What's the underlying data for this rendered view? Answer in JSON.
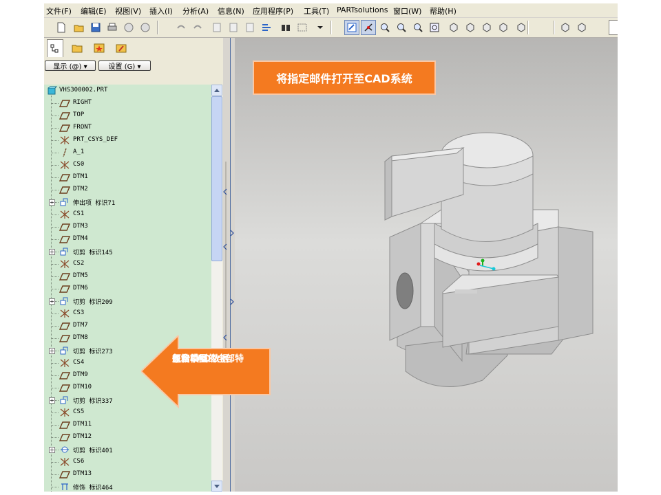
{
  "menu": [
    "文件(F)",
    "编辑(E)",
    "视图(V)",
    "插入(I)",
    "分析(A)",
    "信息(N)",
    "应用程序(P)",
    "工具(T)",
    "PARTsolutions",
    "窗口(W)",
    "帮助(H)"
  ],
  "toolbar_icons": [
    "new-icon",
    "open-icon",
    "save-icon",
    "print-icon",
    "email-icon",
    "email-attach-icon",
    "undo-icon",
    "redo-icon",
    "copy-icon",
    "paste-icon",
    "paste-special-icon",
    "regenerate-icon",
    "find-icon",
    "select-box-icon",
    "select-dropdown-icon",
    "repaint-icon",
    "spin-center-icon",
    "orient-icon",
    "zoom-in-icon",
    "zoom-out-icon",
    "refit-icon",
    "reorient-icon",
    "saved-views-icon",
    "layers-icon",
    "view-manager-icon",
    "shading-icon",
    "hidden-line-icon",
    "no-hidden-icon"
  ],
  "nav": {
    "tabs": [
      "model-tree-tab",
      "folder-browser-tab",
      "favorites-tab",
      "connections-tab"
    ],
    "show_label": "显示 (@) ▾",
    "settings_label": "设置 (G) ▾"
  },
  "tree": [
    {
      "label": "VHS300002.PRT",
      "type": "part",
      "indent": 0,
      "expand": false
    },
    {
      "label": "RIGHT",
      "type": "plane",
      "indent": 1,
      "expand": false
    },
    {
      "label": "TOP",
      "type": "plane",
      "indent": 1,
      "expand": false
    },
    {
      "label": "FRONT",
      "type": "plane",
      "indent": 1,
      "expand": false
    },
    {
      "label": "PRT_CSYS_DEF",
      "type": "csys",
      "indent": 1,
      "expand": false
    },
    {
      "label": "A_1",
      "type": "axis",
      "indent": 1,
      "expand": false
    },
    {
      "label": "CS0",
      "type": "csys",
      "indent": 1,
      "expand": false
    },
    {
      "label": "DTM1",
      "type": "plane",
      "indent": 1,
      "expand": false
    },
    {
      "label": "DTM2",
      "type": "plane",
      "indent": 1,
      "expand": false
    },
    {
      "label": "伸出项 标识71",
      "type": "extrude",
      "indent": 1,
      "expand": true
    },
    {
      "label": "CS1",
      "type": "csys",
      "indent": 1,
      "expand": false
    },
    {
      "label": "DTM3",
      "type": "plane",
      "indent": 1,
      "expand": false
    },
    {
      "label": "DTM4",
      "type": "plane",
      "indent": 1,
      "expand": false
    },
    {
      "label": "切剪 标识145",
      "type": "cut",
      "indent": 1,
      "expand": true
    },
    {
      "label": "CS2",
      "type": "csys",
      "indent": 1,
      "expand": false
    },
    {
      "label": "DTM5",
      "type": "plane",
      "indent": 1,
      "expand": false
    },
    {
      "label": "DTM6",
      "type": "plane",
      "indent": 1,
      "expand": false
    },
    {
      "label": "切剪 标识209",
      "type": "cut",
      "indent": 1,
      "expand": true
    },
    {
      "label": "CS3",
      "type": "csys",
      "indent": 1,
      "expand": false
    },
    {
      "label": "DTM7",
      "type": "plane",
      "indent": 1,
      "expand": false
    },
    {
      "label": "DTM8",
      "type": "plane",
      "indent": 1,
      "expand": false
    },
    {
      "label": "切剪 标识273",
      "type": "cut",
      "indent": 1,
      "expand": true
    },
    {
      "label": "CS4",
      "type": "csys",
      "indent": 1,
      "expand": false
    },
    {
      "label": "DTM9",
      "type": "plane",
      "indent": 1,
      "expand": false
    },
    {
      "label": "DTM10",
      "type": "plane",
      "indent": 1,
      "expand": false
    },
    {
      "label": "切剪 标识337",
      "type": "cut",
      "indent": 1,
      "expand": true
    },
    {
      "label": "CS5",
      "type": "csys",
      "indent": 1,
      "expand": false
    },
    {
      "label": "DTM11",
      "type": "plane",
      "indent": 1,
      "expand": false
    },
    {
      "label": "DTM12",
      "type": "plane",
      "indent": 1,
      "expand": false
    },
    {
      "label": "切剪 标识401",
      "type": "revolve",
      "indent": 1,
      "expand": true
    },
    {
      "label": "CS6",
      "type": "csys",
      "indent": 1,
      "expand": false
    },
    {
      "label": "DTM13",
      "type": "plane",
      "indent": 1,
      "expand": false
    },
    {
      "label": "修饰 标识464",
      "type": "cosmetic",
      "indent": 1,
      "expand": false
    }
  ],
  "annotations": {
    "top": "将指定邮件打开至CAD系统",
    "arrow_lines": [
      "原始CAD数据",
      "包含模型的全部特",
      "征和草图"
    ]
  },
  "colors": {
    "callout": "#f47a20",
    "tree_bg": "#cfe8d0",
    "viewport_bg": "#c9c8c6"
  }
}
